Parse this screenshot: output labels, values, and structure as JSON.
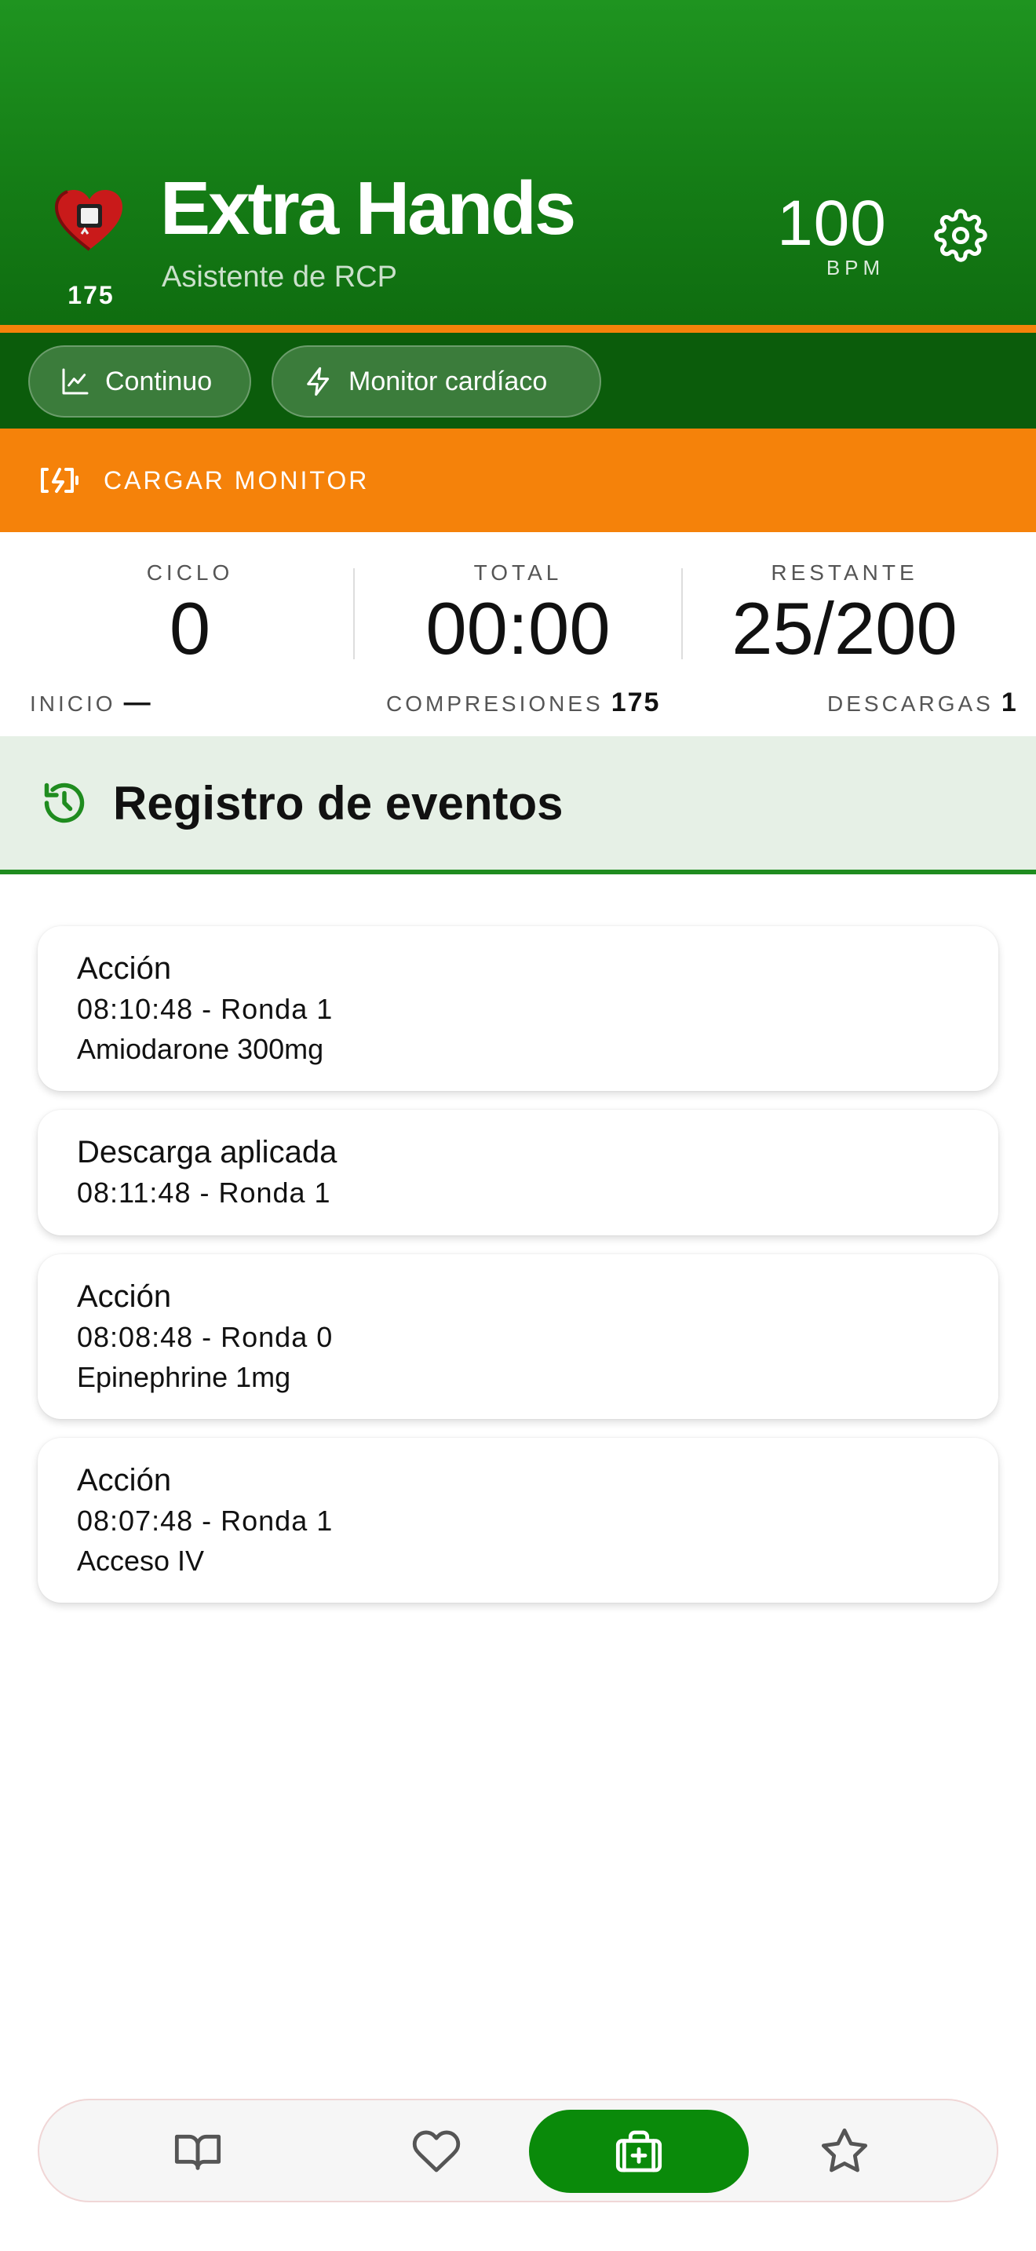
{
  "header": {
    "title": "Extra Hands",
    "subtitle": "Asistente de RCP",
    "logo_count": "175",
    "bpm_value": "100",
    "bpm_unit": "BPM",
    "settings_icon": "gear-icon"
  },
  "modes": [
    {
      "label": "Continuo",
      "icon": "chart-line-icon"
    },
    {
      "label": "Monitor cardíaco",
      "icon": "lightning-icon"
    }
  ],
  "charge": {
    "label": "CARGAR MONITOR",
    "icon": "battery-charging-icon"
  },
  "stats": {
    "ciclo": {
      "label": "CICLO",
      "value": "0"
    },
    "total": {
      "label": "TOTAL",
      "value": "00:00"
    },
    "restante": {
      "label": "RESTANTE",
      "value": "25/200"
    },
    "inicio": {
      "label": "INICIO",
      "value": "—"
    },
    "compresiones": {
      "label": "COMPRESIONES",
      "value": "175"
    },
    "descargas": {
      "label": "DESCARGAS",
      "value": "1"
    }
  },
  "log": {
    "title": "Registro de eventos",
    "icon": "history-icon"
  },
  "events": [
    {
      "title": "Acción",
      "time": "08:10:48 - Ronda 1",
      "detail": "Amiodarone 300mg"
    },
    {
      "title": "Descarga aplicada",
      "time": "08:11:48 - Ronda 1",
      "detail": ""
    },
    {
      "title": "Acción",
      "time": "08:08:48 - Ronda 0",
      "detail": "Epinephrine 1mg"
    },
    {
      "title": "Acción",
      "time": "08:07:48 - Ronda 1",
      "detail": "Acceso IV"
    }
  ],
  "nav": [
    {
      "icon": "book-icon",
      "active": false
    },
    {
      "icon": "heart-icon",
      "active": false
    },
    {
      "icon": "medical-kit-icon",
      "active": true
    },
    {
      "icon": "star-icon",
      "active": false
    }
  ],
  "colors": {
    "primary_green": "#1a8a1a",
    "dark_green": "#0b5c0b",
    "accent_orange": "#f5820a",
    "log_bg": "#e6f0e6",
    "nav_active": "#0a8a0a"
  }
}
